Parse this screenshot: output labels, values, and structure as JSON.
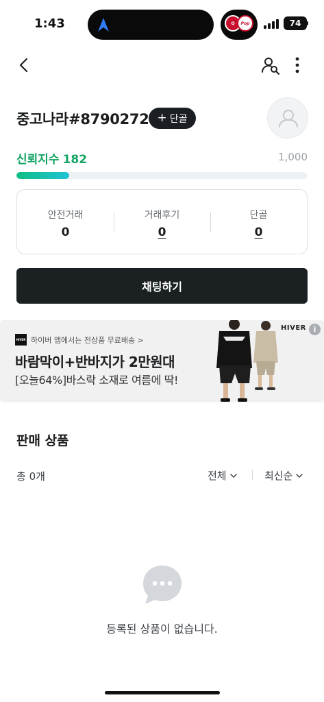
{
  "status_bar": {
    "time": "1:43",
    "battery": "74",
    "app_badge_left": "Q",
    "app_badge_right": "Pop"
  },
  "nav": {
    "back_icon": "chevron-left-icon",
    "user_search_icon": "user-search-icon",
    "more_icon": "more-vertical-icon"
  },
  "profile": {
    "name": "중고나라#8790272",
    "regular_button_plus": "+",
    "regular_button_label": "단골",
    "trust_label": "신뢰지수",
    "trust_score": "182",
    "trust_max": "1,000",
    "trust_progress": 0.182
  },
  "stats": [
    {
      "label": "안전거래",
      "value": "0"
    },
    {
      "label": "거래후기",
      "value": "0"
    },
    {
      "label": "단골",
      "value": "0"
    }
  ],
  "chat_button": "채팅하기",
  "ad": {
    "logo_text": "HIVER",
    "source": "하이버 앱에서는 전상품 무료배송 >",
    "title": "바람막이+반바지가 2만원대",
    "subtitle": "[오늘64%]바스락 소재로 여름에 딱!",
    "brand": "HIVER",
    "info_label": "i"
  },
  "products": {
    "title": "판매 상품",
    "total": "총 0개",
    "filter_all": "전체",
    "filter_sort": "최신순",
    "empty_message": "등록된 상품이 없습니다."
  },
  "colors": {
    "accent_green": "#13a362",
    "dark_button": "#1b2023"
  }
}
